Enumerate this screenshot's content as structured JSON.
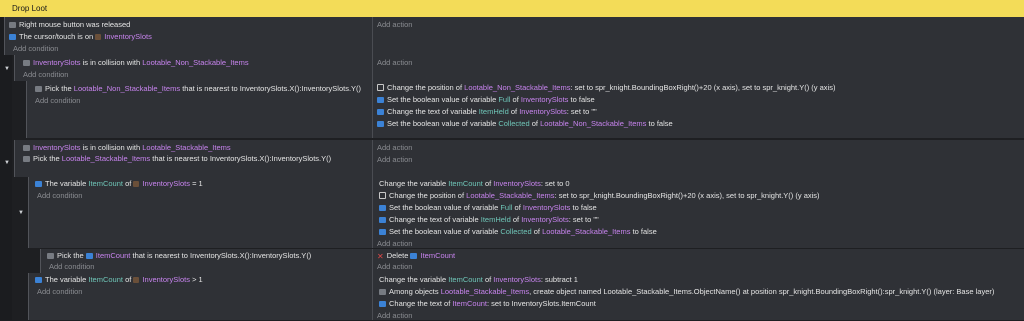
{
  "title": "Drop Loot",
  "add_condition": "Add condition",
  "add_action": "Add action",
  "ev1": {
    "c1": "Right mouse button was released",
    "c2a": "The cursor/touch is on",
    "c2b": "InventorySlots"
  },
  "ev2": {
    "c1a": "InventorySlots",
    "c1b": "is in collision with",
    "c1c": "Lootable_Non_Stackable_Items"
  },
  "ev3": {
    "c1a": "Pick the",
    "c1b": "Lootable_Non_Stackable_Items",
    "c1c": "that is nearest to InventorySlots.X():InventorySlots.Y()",
    "a1a": "Change the position of",
    "a1b": "Lootable_Non_Stackable_Items",
    "a1c": ": set to",
    "a1d": "spr_knight.BoundingBoxRight()+20",
    "a1e": "(x axis),",
    "a1f": "set to",
    "a1g": "spr_knight.Y()",
    "a1h": "(y axis)",
    "a2a": "Set the boolean value of variable",
    "a2b": "Full",
    "a2c": "of",
    "a2d": "InventorySlots",
    "a2e": "to false",
    "a3a": "Change the text of variable",
    "a3b": "ItemHeld",
    "a3c": "of",
    "a3d": "InventorySlots",
    "a3e": ": set to \"\"",
    "a4a": "Set the boolean value of variable",
    "a4b": "Collected",
    "a4c": "of",
    "a4d": "Lootable_Non_Stackable_Items",
    "a4e": "to false"
  },
  "ev4": {
    "c1a": "InventorySlots",
    "c1b": "is in collision with",
    "c1c": "Lootable_Stackable_Items",
    "c2a": "Pick the",
    "c2b": "Lootable_Stackable_Items",
    "c2c": "that is nearest to InventorySlots.X():InventorySlots.Y()"
  },
  "ev5": {
    "c1a": "The variable",
    "c1b": "ItemCount",
    "c1c": "of",
    "c1d": "InventorySlots",
    "c1e": "= 1",
    "a1a": "Change the variable",
    "a1b": "ItemCount",
    "a1c": "of",
    "a1d": "InventorySlots",
    "a1e": ": set to 0",
    "a2a": "Change the position of",
    "a2b": "Lootable_Stackable_Items",
    "a2c": ": set to",
    "a2d": "spr_knight.BoundingBoxRight()+20",
    "a2e": "(x axis),",
    "a2f": "set to",
    "a2g": "spr_knight.Y()",
    "a2h": "(y axis)",
    "a3a": "Set the boolean value of variable",
    "a3b": "Full",
    "a3c": "of",
    "a3d": "InventorySlots",
    "a3e": "to false",
    "a4a": "Change the text of variable",
    "a4b": "ItemHeld",
    "a4c": "of",
    "a4d": "InventorySlots",
    "a4e": ": set to \"\"",
    "a5a": "Set the boolean value of variable",
    "a5b": "Collected",
    "a5c": "of",
    "a5d": "Lootable_Stackable_Items",
    "a5e": "to false"
  },
  "ev6": {
    "c1a": "Pick the",
    "c1b": "ItemCount",
    "c1c": "that is nearest to InventorySlots.X():InventorySlots.Y()",
    "a1a": "Delete",
    "a1b": "ItemCount"
  },
  "ev7": {
    "c1a": "The variable",
    "c1b": "ItemCount",
    "c1c": "of",
    "c1d": "InventorySlots",
    "c1e": "> 1",
    "a1a": "Change the variable",
    "a1b": "ItemCount",
    "a1c": "of",
    "a1d": "InventorySlots",
    "a1e": ": subtract 1",
    "a2a": "Among objects",
    "a2b": "Lootable_Stackable_Items",
    "a2c": ", create object named Lootable_Stackable_Items.ObjectName() at position spr_knight.BoundingBoxRight():spr_knight.Y() (layer: Base layer)",
    "a3a": "Change the text of",
    "a3b": "ItemCount",
    "a3c": ": set to InventorySlots.ItemCount"
  }
}
